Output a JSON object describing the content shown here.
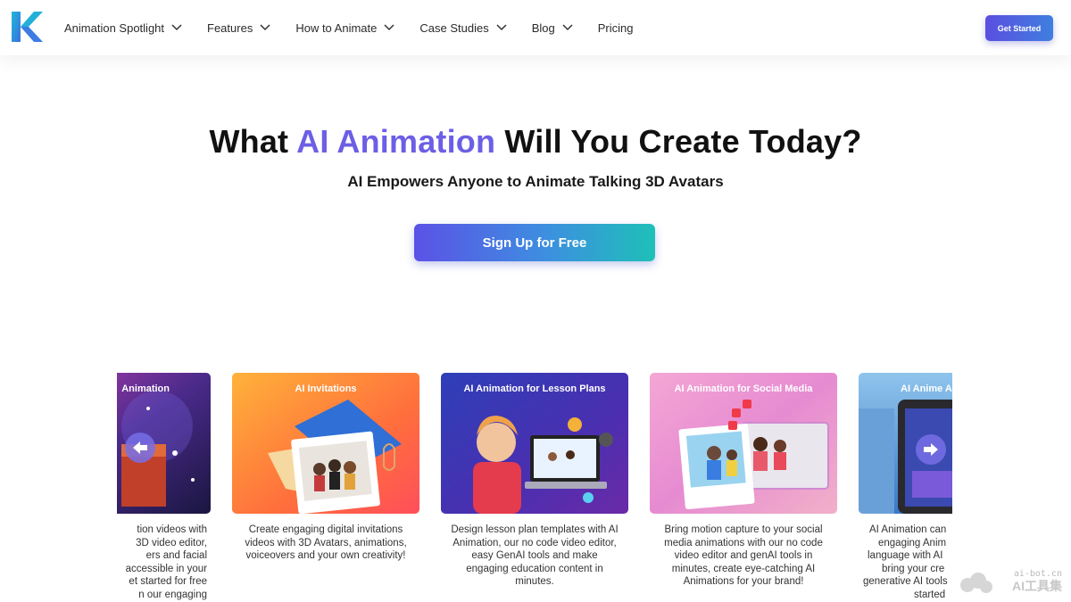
{
  "nav": {
    "logo_letter": "K",
    "items": [
      {
        "label": "Animation Spotlight",
        "dropdown": true
      },
      {
        "label": "Features",
        "dropdown": true
      },
      {
        "label": "How to Animate",
        "dropdown": true
      },
      {
        "label": "Case Studies",
        "dropdown": true
      },
      {
        "label": "Blog",
        "dropdown": true
      },
      {
        "label": "Pricing",
        "dropdown": false
      }
    ],
    "cta_label": "Get Started"
  },
  "hero": {
    "title_before": "What ",
    "title_accent": "AI Animation",
    "title_after": " Will You Create Today?",
    "subtitle": "AI Empowers Anyone to Animate Talking 3D Avatars",
    "signup_label": "Sign Up for Free"
  },
  "cards": [
    {
      "title": "Animation",
      "desc_lines": [
        "tion videos with",
        "3D video editor,",
        "ers and facial",
        "accessible in your",
        "et started for free",
        "n our engaging"
      ]
    },
    {
      "title": "AI Invitations",
      "desc_lines": [
        "Create engaging digital invitations",
        "videos with 3D Avatars, animations,",
        "voiceovers and your own creativity!"
      ]
    },
    {
      "title": "AI Animation for Lesson Plans",
      "desc_lines": [
        "Design lesson plan templates with AI",
        "Animation, our no code video editor,",
        "easy GenAI tools and make",
        "engaging education content in",
        "minutes."
      ]
    },
    {
      "title": "AI Animation for Social Media",
      "desc_lines": [
        "Bring motion capture to your social",
        "media animations with our no code",
        "video editor and genAI tools in",
        "minutes, create eye-catching AI",
        "Animations for your brand!"
      ]
    },
    {
      "title": "AI Anime A",
      "desc_lines": [
        "AI Animation can",
        "engaging Anim",
        "language with AI",
        "bring your cre",
        "generative AI tools",
        "started"
      ]
    }
  ],
  "watermark": {
    "line1": "ai-bot.cn",
    "line2": "AI工具集"
  },
  "colors": {
    "accent": "#6c5fe6",
    "brand_teal": "#1ec0b8"
  }
}
